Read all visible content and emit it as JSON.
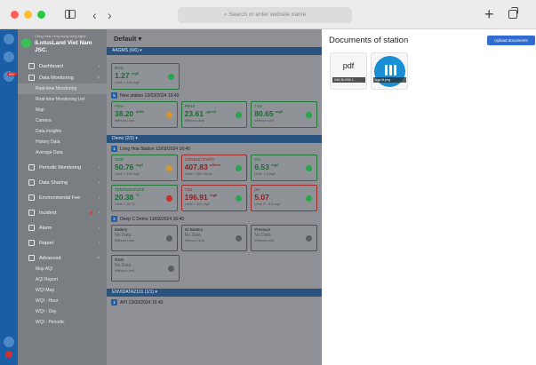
{
  "browser": {
    "url_placeholder": "Search or enter website name",
    "back_icon": "chevron-left-icon",
    "forward_icon": "chevron-right-icon"
  },
  "brand": {
    "subtitle": "Cùng nhau ứng dụng công nghệ",
    "name_line1": "iLotusLand Viet Nam",
    "name_line2": "JSC."
  },
  "rail": {
    "badge": "99+"
  },
  "nav": {
    "dashboard": "Dashboard",
    "data_monitoring": "Data Monitoring",
    "sub_monitoring": [
      "Real-time Monitoring",
      "Real-time Monitoring List",
      "Map",
      "Camera",
      "Data Insights",
      "History Data",
      "Average Data"
    ],
    "periodic_monitoring": "Periodic Monitoring",
    "data_sharing": "Data Sharing",
    "environmental_fee": "Environmental Fee",
    "incident": "Incident",
    "alarm": "Alarm",
    "report": "Report",
    "advanced": "Advanced",
    "sub_advanced": [
      "Map AQI",
      "AQI Report",
      "WQI Map",
      "WQI - Hour",
      "WQI - Day",
      "WQI - Periodic"
    ]
  },
  "main": {
    "filter": "Default ▾",
    "groups": [
      {
        "label": "AAGMS (6/6) ▾"
      },
      {
        "label": "Demo (2/3) ▾"
      },
      {
        "label": "ENVIDATA2101 (1/1) ▾"
      }
    ],
    "top_cards": [
      {
        "label": "BOD",
        "value": "1.27",
        "unit": "mg/l",
        "limit": "Limit: < 100 mg/l"
      }
    ],
    "station1": {
      "num": "5",
      "title": "New station 13/03/2024 16:40"
    },
    "station1_cards": [
      {
        "label": "Flow",
        "value": "38.20",
        "unit": "m3/h",
        "limit": "Without Limit"
      },
      {
        "label": "PM10",
        "value": "23.61",
        "unit": "µg/m3",
        "limit": "Without Limit"
      },
      {
        "label": "TSS",
        "value": "80.65",
        "unit": "mg/l",
        "limit": "Without Limit"
      }
    ],
    "station2": {
      "num": "1",
      "title": "Long Hoa Station 13/03/2024 16:40"
    },
    "station2_cards": [
      {
        "label": "COD",
        "value": "50.76",
        "unit": "mg/l",
        "limit": "Limit: < 100 mg/l"
      },
      {
        "label": "CONDUCTIVITY",
        "value": "407.83",
        "unit": "uS/cm",
        "limit": "Limit: < 300 uS/cm"
      },
      {
        "label": "DO",
        "value": "6.53",
        "unit": "mg/l",
        "limit": "Limit: > 4 mg/l"
      }
    ],
    "station2_cards_b": [
      {
        "label": "TEMPERATURE",
        "value": "20.38",
        "unit": "°C",
        "limit": "Limit: < 35 °C"
      },
      {
        "label": "TSS",
        "value": "196.91",
        "unit": "mg/l",
        "limit": "Limit: < 100 mg/l"
      },
      {
        "label": "pH",
        "value": "5.07",
        "unit": "",
        "limit": "Limit: 6 - 8.5 mg/l"
      }
    ],
    "station3": {
      "num": "2",
      "title": "Deep C Demo 13/03/2024 16:40"
    },
    "station3_cards": [
      {
        "label": "Battery",
        "value": "No Data",
        "limit": "Without Limit"
      },
      {
        "label": "Int Battery",
        "value": "No Data",
        "limit": "Without Limit"
      },
      {
        "label": "Pressure",
        "value": "No Data",
        "limit": "Without Limit"
      }
    ],
    "station3_card_b": {
      "label": "RSSI",
      "value": "No Data",
      "limit": "Without Limit"
    },
    "station4": {
      "num": "1",
      "title": "API 13/03/2024 16:40"
    }
  },
  "panel": {
    "title": "Documents of station",
    "upload_label": "Upload documents",
    "docs": [
      {
        "type_label": "pdf",
        "caption": "VAN BUOM-1..."
      },
      {
        "type_label": "",
        "caption": "logo ilt.png"
      }
    ]
  }
}
